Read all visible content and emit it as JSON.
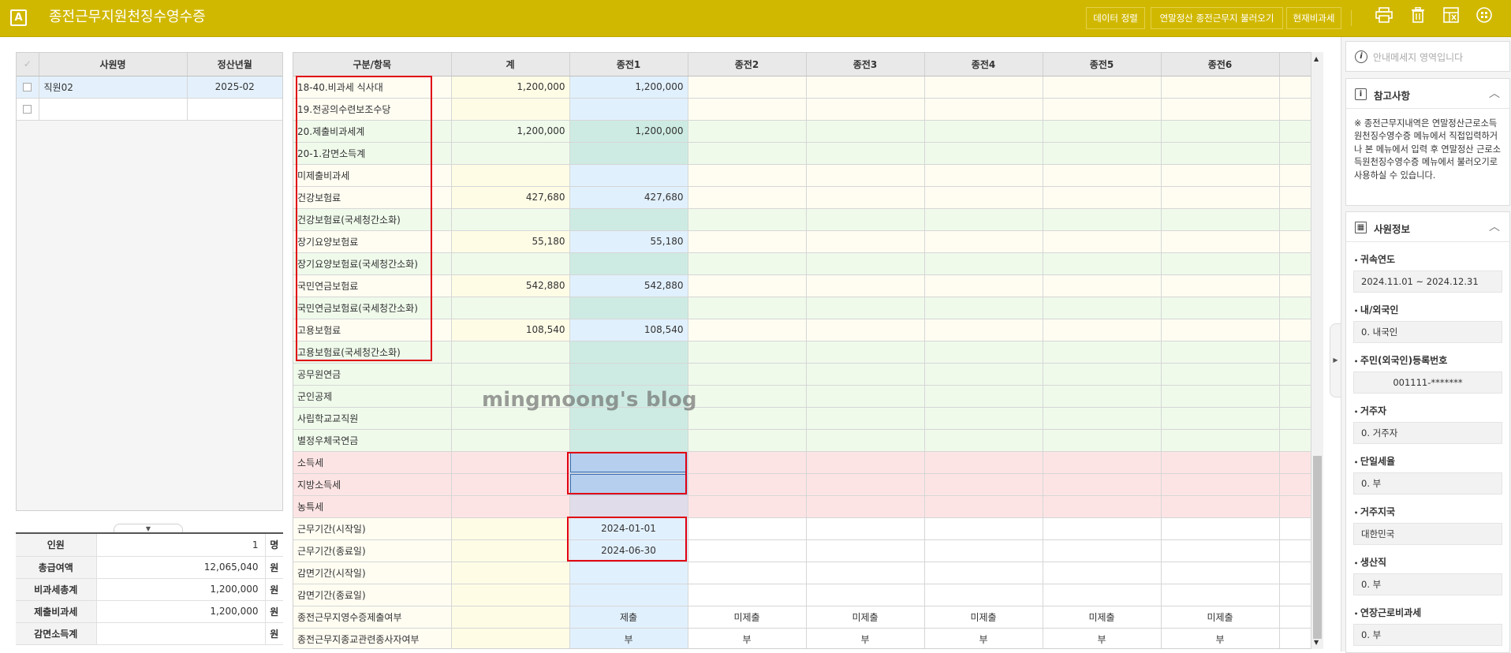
{
  "app": {
    "logo": "A",
    "title": "종전근무지원천징수영수증"
  },
  "toolbar": {
    "buttons": [
      "데이터 정렬",
      "연말정산 종전근무지 불러오기",
      "현재비과세"
    ],
    "icons": [
      "printer-icon",
      "trash-icon",
      "spreadsheet-icon",
      "grid-menu-icon"
    ]
  },
  "employee_grid": {
    "headers": [
      "사원명",
      "정산년월"
    ],
    "rows": [
      {
        "name": "직원02",
        "month": "2025-02"
      },
      {
        "name": "",
        "month": ""
      }
    ]
  },
  "summary": [
    {
      "label": "인원",
      "value": "1",
      "unit": "명"
    },
    {
      "label": "총급여액",
      "value": "12,065,040",
      "unit": "원"
    },
    {
      "label": "비과세총계",
      "value": "1,200,000",
      "unit": "원"
    },
    {
      "label": "제출비과세",
      "value": "1,200,000",
      "unit": "원"
    },
    {
      "label": "감면소득계",
      "value": "",
      "unit": "원"
    }
  ],
  "main_grid": {
    "headers": [
      "구분/항목",
      "계",
      "종전1",
      "종전2",
      "종전3",
      "종전4",
      "종전5",
      "종전6"
    ],
    "rows": [
      {
        "label": "18-40.비과세 식사대",
        "values": [
          "1,200,000",
          "1,200,000",
          "",
          "",
          "",
          "",
          ""
        ],
        "tone": "y"
      },
      {
        "label": "19.전공의수련보조수당",
        "values": [
          "",
          "",
          "",
          "",
          "",
          "",
          ""
        ],
        "tone": "y"
      },
      {
        "label": "20.제출비과세계",
        "values": [
          "1,200,000",
          "1,200,000",
          "",
          "",
          "",
          "",
          ""
        ],
        "tone": "g"
      },
      {
        "label": "20-1.감면소득계",
        "values": [
          "",
          "",
          "",
          "",
          "",
          "",
          ""
        ],
        "tone": "g"
      },
      {
        "label": "미제출비과세",
        "values": [
          "",
          "",
          "",
          "",
          "",
          "",
          ""
        ],
        "tone": "y"
      },
      {
        "label": "건강보험료",
        "values": [
          "427,680",
          "427,680",
          "",
          "",
          "",
          "",
          ""
        ],
        "tone": "y"
      },
      {
        "label": "건강보험료(국세청간소화)",
        "values": [
          "",
          "",
          "",
          "",
          "",
          "",
          ""
        ],
        "tone": "g"
      },
      {
        "label": "장기요양보험료",
        "values": [
          "55,180",
          "55,180",
          "",
          "",
          "",
          "",
          ""
        ],
        "tone": "y"
      },
      {
        "label": "장기요양보험료(국세청간소화)",
        "values": [
          "",
          "",
          "",
          "",
          "",
          "",
          ""
        ],
        "tone": "g"
      },
      {
        "label": "국민연금보험료",
        "values": [
          "542,880",
          "542,880",
          "",
          "",
          "",
          "",
          ""
        ],
        "tone": "y"
      },
      {
        "label": "국민연금보험료(국세청간소화)",
        "values": [
          "",
          "",
          "",
          "",
          "",
          "",
          ""
        ],
        "tone": "g"
      },
      {
        "label": "고용보험료",
        "values": [
          "108,540",
          "108,540",
          "",
          "",
          "",
          "",
          ""
        ],
        "tone": "y"
      },
      {
        "label": "고용보험료(국세청간소화)",
        "values": [
          "",
          "",
          "",
          "",
          "",
          "",
          ""
        ],
        "tone": "g"
      },
      {
        "label": "공무원연금",
        "values": [
          "",
          "",
          "",
          "",
          "",
          "",
          ""
        ],
        "tone": "g"
      },
      {
        "label": "군인공제",
        "values": [
          "",
          "",
          "",
          "",
          "",
          "",
          ""
        ],
        "tone": "g"
      },
      {
        "label": "사립학교교직원",
        "values": [
          "",
          "",
          "",
          "",
          "",
          "",
          ""
        ],
        "tone": "g"
      },
      {
        "label": "별정우체국연금",
        "values": [
          "",
          "",
          "",
          "",
          "",
          "",
          ""
        ],
        "tone": "g"
      },
      {
        "label": "소득세",
        "values": [
          "",
          "",
          "",
          "",
          "",
          "",
          ""
        ],
        "tone": "p"
      },
      {
        "label": "지방소득세",
        "values": [
          "",
          "",
          "",
          "",
          "",
          "",
          ""
        ],
        "tone": "p"
      },
      {
        "label": "농특세",
        "values": [
          "",
          "",
          "",
          "",
          "",
          "",
          ""
        ],
        "tone": "p"
      },
      {
        "label": "근무기간(시작일)",
        "values": [
          "",
          "2024-01-01",
          "",
          "",
          "",
          "",
          ""
        ],
        "tone": "w"
      },
      {
        "label": "근무기간(종료일)",
        "values": [
          "",
          "2024-06-30",
          "",
          "",
          "",
          "",
          ""
        ],
        "tone": "w"
      },
      {
        "label": "감면기간(시작일)",
        "values": [
          "",
          "",
          "",
          "",
          "",
          "",
          ""
        ],
        "tone": "w"
      },
      {
        "label": "감면기간(종료일)",
        "values": [
          "",
          "",
          "",
          "",
          "",
          "",
          ""
        ],
        "tone": "w"
      },
      {
        "label": "종전근무지영수증제출여부",
        "values": [
          "",
          "제출",
          "미제출",
          "미제출",
          "미제출",
          "미제출",
          "미제출"
        ],
        "tone": "w"
      },
      {
        "label": "종전근무지종교관련종사자여부",
        "values": [
          "",
          "부",
          "부",
          "부",
          "부",
          "부",
          "부"
        ],
        "tone": "w"
      }
    ]
  },
  "watermark": "mingmoong's blog",
  "right_panel": {
    "message_placeholder": "안내메세지 영역입니다",
    "notes": {
      "title": "참고사항",
      "text": "※ 종전근무지내역은 연말정산근로소득원천징수영수증 메뉴에서 직접입력하거나 본 메뉴에서 입력 후 연말정산 근로소득원천징수영수증 메뉴에서 불러오기로 사용하실 수 있습니다."
    },
    "employee_info": {
      "title": "사원정보",
      "fields": [
        {
          "label": "귀속연도",
          "value": "2024.11.01 ~ 2024.12.31"
        },
        {
          "label": "내/외국인",
          "value": "0. 내국인"
        },
        {
          "label": "주민(외국인)등록번호",
          "value": "001111-*******"
        },
        {
          "label": "거주자",
          "value": "0. 거주자"
        },
        {
          "label": "단일세율",
          "value": "0. 부"
        },
        {
          "label": "거주지국",
          "value": "대한민국"
        },
        {
          "label": "생산직",
          "value": "0. 부"
        },
        {
          "label": "연장근로비과세",
          "value": "0. 부"
        }
      ]
    }
  },
  "colors": {
    "header_bg": "#d1b800",
    "highlight": "#e00012",
    "selection": "#b6cfee"
  }
}
